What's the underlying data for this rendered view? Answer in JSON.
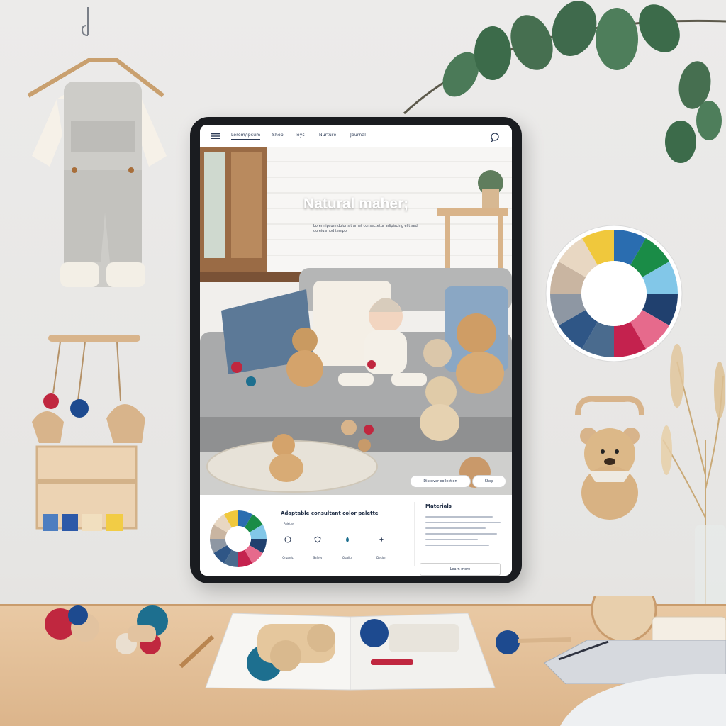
{
  "nav": {
    "links": [
      "Lorem/ipsum",
      "Shop",
      "Toys",
      "Nurture",
      "Journal"
    ],
    "active_index": 0
  },
  "hero": {
    "title": "Natural maher;",
    "subtitle": "Lorem ipsum dolor sit amet consectetur adipiscing elit sed do eiusmod tempor",
    "primary_button": "Discover collection",
    "secondary_button": "Shop"
  },
  "palette": {
    "title": "Adaptable consultant color palette",
    "tag": "Palette",
    "features": [
      "Organic",
      "Safety",
      "Quality",
      "Design"
    ]
  },
  "side_panel": {
    "title": "Materials",
    "button": "Learn more"
  },
  "colors": {
    "wheel": [
      "#2a6db0",
      "#1a8c47",
      "#82c7e8",
      "#20406e",
      "#e66a8c",
      "#c4224e",
      "#4a6b8e",
      "#2f5686",
      "#8e97a3",
      "#c9b5a1",
      "#e8d7c2",
      "#f0c83c"
    ],
    "navy": "#2b3a55"
  }
}
